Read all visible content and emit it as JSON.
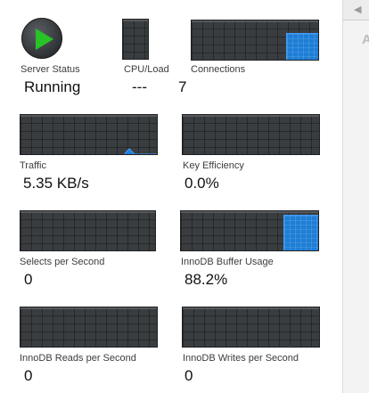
{
  "colors": {
    "graph_background": "#3a3d40",
    "graph_fill": "#1f7ed6",
    "play_icon": "#27c327"
  },
  "side_panel": {
    "arrow_icon": "triangle-left-icon",
    "partial_letter": "A"
  },
  "server_status": {
    "label": "Server Status",
    "value": "Running",
    "icon": "play-icon"
  },
  "cpu_load": {
    "label": "CPU/Load",
    "value": "---"
  },
  "connections": {
    "label": "Connections",
    "value": "7",
    "fill_fraction": 0.65
  },
  "traffic": {
    "label": "Traffic",
    "value": "5.35 KB/s"
  },
  "key_efficiency": {
    "label": "Key Efficiency",
    "value": "0.0%"
  },
  "selects_per_second": {
    "label": "Selects per Second",
    "value": "0"
  },
  "innodb_buffer_usage": {
    "label": "InnoDB Buffer Usage",
    "value": "88.2%",
    "fill_fraction": 0.882
  },
  "innodb_reads": {
    "label": "InnoDB Reads per Second",
    "value": "0"
  },
  "innodb_writes": {
    "label": "InnoDB Writes per Second",
    "value": "0"
  }
}
